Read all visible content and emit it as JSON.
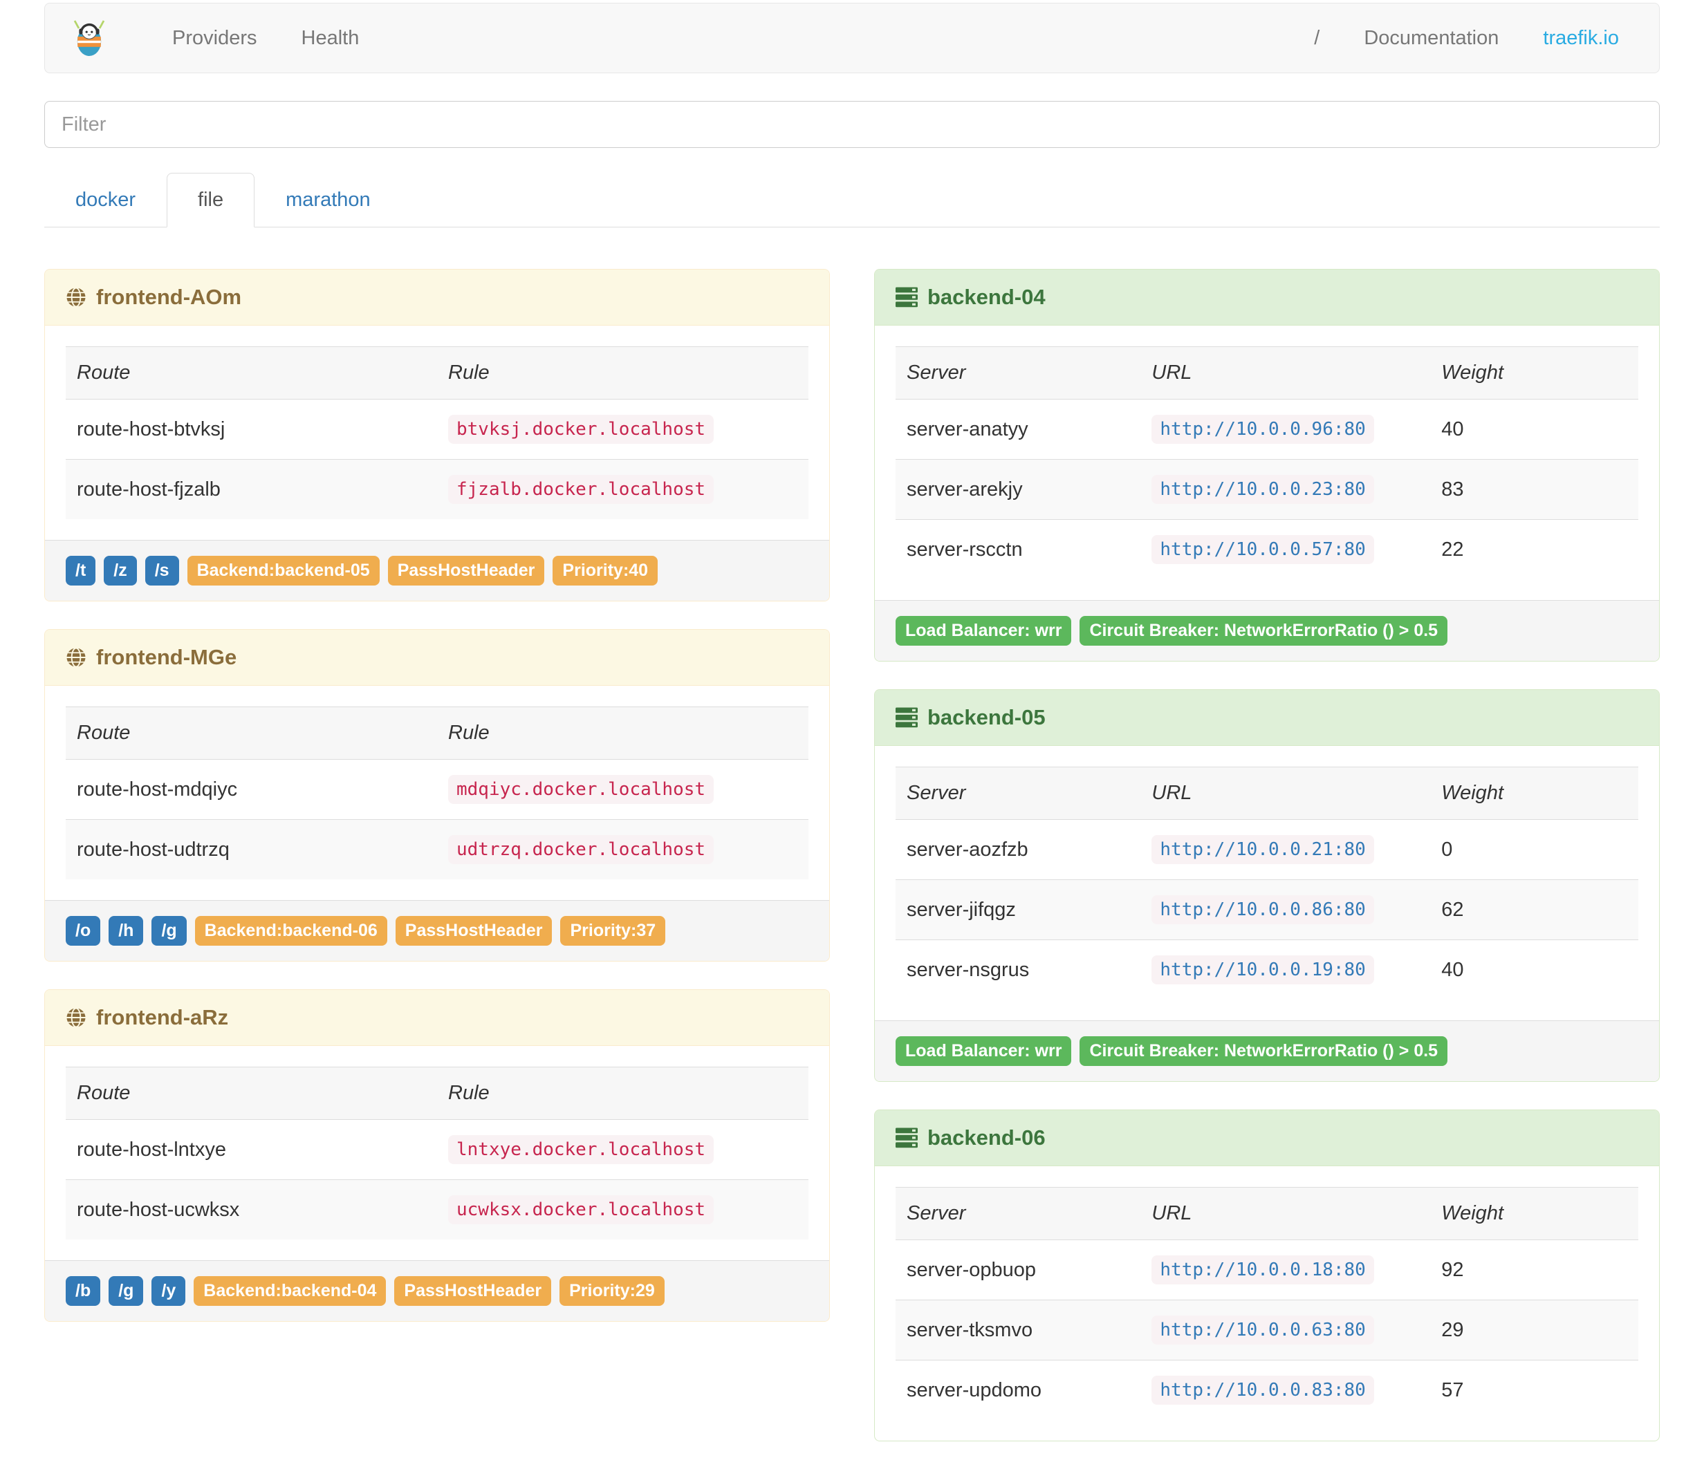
{
  "navbar": {
    "left_links": [
      "Providers",
      "Health"
    ],
    "right_links": [
      "/",
      "Documentation",
      "traefik.io"
    ]
  },
  "filter": {
    "placeholder": "Filter"
  },
  "tabs": [
    {
      "label": "docker",
      "active": false
    },
    {
      "label": "file",
      "active": true
    },
    {
      "label": "marathon",
      "active": false
    }
  ],
  "frontends": [
    {
      "title": "frontend-AOm",
      "columns": [
        "Route",
        "Rule"
      ],
      "routes": [
        {
          "route": "route-host-btvksj",
          "rule": "btvksj.docker.localhost"
        },
        {
          "route": "route-host-fjzalb",
          "rule": "fjzalb.docker.localhost"
        }
      ],
      "entry_labels": [
        "/t",
        "/z",
        "/s"
      ],
      "prop_labels": [
        "Backend:backend-05",
        "PassHostHeader",
        "Priority:40"
      ]
    },
    {
      "title": "frontend-MGe",
      "columns": [
        "Route",
        "Rule"
      ],
      "routes": [
        {
          "route": "route-host-mdqiyc",
          "rule": "mdqiyc.docker.localhost"
        },
        {
          "route": "route-host-udtrzq",
          "rule": "udtrzq.docker.localhost"
        }
      ],
      "entry_labels": [
        "/o",
        "/h",
        "/g"
      ],
      "prop_labels": [
        "Backend:backend-06",
        "PassHostHeader",
        "Priority:37"
      ]
    },
    {
      "title": "frontend-aRz",
      "columns": [
        "Route",
        "Rule"
      ],
      "routes": [
        {
          "route": "route-host-lntxye",
          "rule": "lntxye.docker.localhost"
        },
        {
          "route": "route-host-ucwksx",
          "rule": "ucwksx.docker.localhost"
        }
      ],
      "entry_labels": [
        "/b",
        "/g",
        "/y"
      ],
      "prop_labels": [
        "Backend:backend-04",
        "PassHostHeader",
        "Priority:29"
      ]
    }
  ],
  "backends": [
    {
      "title": "backend-04",
      "columns": [
        "Server",
        "URL",
        "Weight"
      ],
      "servers": [
        {
          "name": "server-anatyy",
          "url": "http://10.0.0.96:80",
          "weight": "40"
        },
        {
          "name": "server-arekjy",
          "url": "http://10.0.0.23:80",
          "weight": "83"
        },
        {
          "name": "server-rscctn",
          "url": "http://10.0.0.57:80",
          "weight": "22"
        }
      ],
      "prop_labels": [
        "Load Balancer: wrr",
        "Circuit Breaker: NetworkErrorRatio () > 0.5"
      ]
    },
    {
      "title": "backend-05",
      "columns": [
        "Server",
        "URL",
        "Weight"
      ],
      "servers": [
        {
          "name": "server-aozfzb",
          "url": "http://10.0.0.21:80",
          "weight": "0"
        },
        {
          "name": "server-jifqgz",
          "url": "http://10.0.0.86:80",
          "weight": "62"
        },
        {
          "name": "server-nsgrus",
          "url": "http://10.0.0.19:80",
          "weight": "40"
        }
      ],
      "prop_labels": [
        "Load Balancer: wrr",
        "Circuit Breaker: NetworkErrorRatio () > 0.5"
      ]
    },
    {
      "title": "backend-06",
      "columns": [
        "Server",
        "URL",
        "Weight"
      ],
      "servers": [
        {
          "name": "server-opbuop",
          "url": "http://10.0.0.18:80",
          "weight": "92"
        },
        {
          "name": "server-tksmvo",
          "url": "http://10.0.0.63:80",
          "weight": "29"
        },
        {
          "name": "server-updomo",
          "url": "http://10.0.0.83:80",
          "weight": "57"
        }
      ],
      "prop_labels": []
    }
  ],
  "colors": {
    "primary_blue": "#337ab7",
    "warning_orange": "#f0ad4e",
    "success_green": "#5cb85c",
    "frontend_text": "#8a6d3b",
    "frontend_bg": "#fcf8e3",
    "backend_text": "#3c763d",
    "backend_bg": "#dff0d8",
    "code_pink": "#c7254e",
    "code_bg": "#f9f2f4",
    "traefik_cyan": "#29ABE2"
  }
}
